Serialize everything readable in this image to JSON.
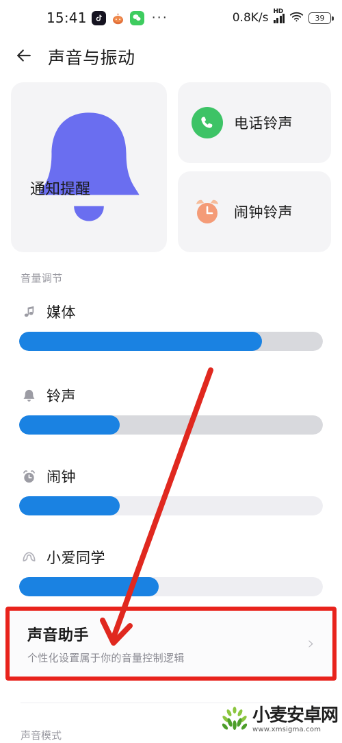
{
  "statusbar": {
    "clock": "15:41",
    "app_icons": [
      "tiktok-icon",
      "orange-app-icon",
      "wechat-icon"
    ],
    "overflow": "···",
    "network_speed": "0.8K/s",
    "hd_label": "HD",
    "signal": "signal-bars-icon",
    "wifi": "wifi-icon",
    "battery_percent": "39"
  },
  "header": {
    "back": "back-arrow-icon",
    "title": "声音与振动"
  },
  "cards": {
    "notification": {
      "label": "通知提醒",
      "icon": "bell-icon",
      "icon_color": "#6a6ef0"
    },
    "phone_ringtone": {
      "label": "电话铃声",
      "icon": "phone-icon",
      "icon_color": "#3dc366"
    },
    "alarm_ringtone": {
      "label": "闹钟铃声",
      "icon": "alarm-clock-icon",
      "icon_color": "#f49b77"
    }
  },
  "volume": {
    "section_title": "音量调节",
    "fill_color": "#1a82e2",
    "rows": [
      {
        "label": "媒体",
        "icon": "music-note-icon",
        "value": 80,
        "track_color": "#d8d9dd"
      },
      {
        "label": "铃声",
        "icon": "bell-icon",
        "value": 33,
        "track_color": "#d8d9dd"
      },
      {
        "label": "闹钟",
        "icon": "alarm-clock-icon",
        "value": 33,
        "track_color": "#eeeef2"
      },
      {
        "label": "小爱同学",
        "icon": "xiaoai-icon",
        "value": 46,
        "track_color": "#eeeef2"
      }
    ]
  },
  "sound_assistant": {
    "title": "声音助手",
    "subtitle": "个性化设置属于你的音量控制逻辑",
    "chevron": "›",
    "highlight_color": "#e8231c"
  },
  "bottom": {
    "section_title": "声音模式"
  },
  "annotation": {
    "color": "#e0281f",
    "type": "arrow"
  },
  "watermark": {
    "name": "小麦安卓网",
    "url": "www.xmsigma.com"
  }
}
